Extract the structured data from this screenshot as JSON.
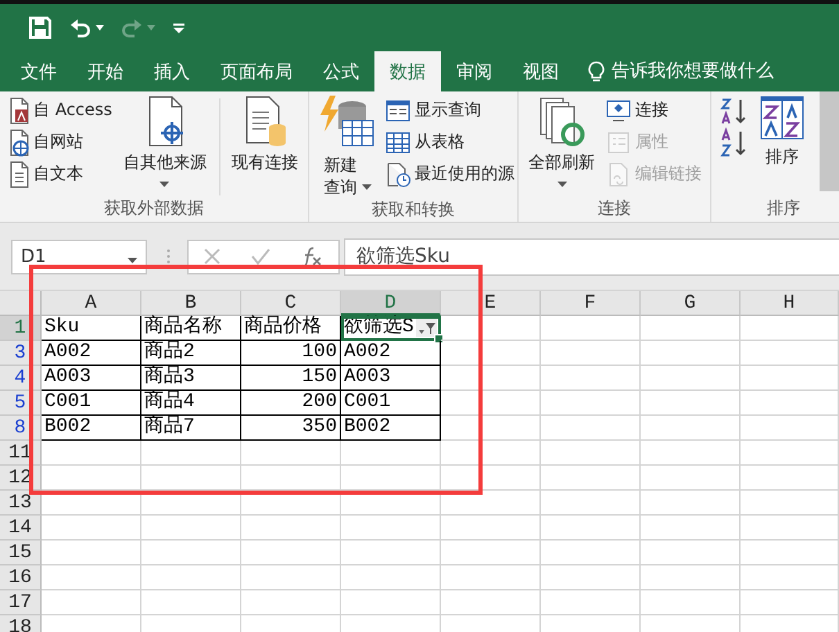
{
  "quick_access": [
    {
      "kind": "save",
      "disabled": false
    },
    {
      "kind": "undo",
      "disabled": false
    },
    {
      "kind": "redo",
      "disabled": true
    },
    {
      "kind": "customize",
      "disabled": false
    }
  ],
  "tabs": [
    {
      "label": "文件",
      "selected": false
    },
    {
      "label": "开始",
      "selected": false
    },
    {
      "label": "插入",
      "selected": false
    },
    {
      "label": "页面布局",
      "selected": false
    },
    {
      "label": "公式",
      "selected": false
    },
    {
      "label": "数据",
      "selected": true
    },
    {
      "label": "审阅",
      "selected": false
    },
    {
      "label": "视图",
      "selected": false
    }
  ],
  "tell_me": {
    "placeholder": "告诉我你想要做什么"
  },
  "ribbon_groups": [
    {
      "label": "获取外部数据",
      "items": [
        {
          "kind": "stack",
          "items": [
            {
              "label": "自 Access",
              "disabled": false
            },
            {
              "label": "自网站",
              "disabled": false
            },
            {
              "label": "自文本",
              "disabled": false
            }
          ]
        },
        {
          "kind": "large",
          "label": "自其他来源",
          "dropdown": true
        },
        {
          "kind": "separator"
        },
        {
          "kind": "large",
          "label": "现有连接",
          "dropdown": false
        }
      ]
    },
    {
      "label": "获取和转换",
      "items": [
        {
          "kind": "large",
          "label": "新建查询",
          "dropdown": true
        },
        {
          "kind": "stack",
          "items": [
            {
              "label": "显示查询",
              "disabled": false
            },
            {
              "label": "从表格",
              "disabled": false
            },
            {
              "label": "最近使用的源",
              "disabled": false
            }
          ]
        }
      ]
    },
    {
      "label": "连接",
      "items": [
        {
          "kind": "large",
          "label": "全部刷新",
          "dropdown": true
        },
        {
          "kind": "stack",
          "items": [
            {
              "label": "连接",
              "disabled": false
            },
            {
              "label": "属性",
              "disabled": true
            },
            {
              "label": "编辑链接",
              "disabled": true
            }
          ]
        }
      ]
    },
    {
      "label": "排序",
      "items": [
        {
          "kind": "stack",
          "items": [
            {
              "disabled": false
            },
            {
              "disabled": false
            }
          ]
        },
        {
          "kind": "large",
          "label": "排序",
          "dropdown": false
        },
        {
          "kind": "cut"
        }
      ]
    }
  ],
  "formula_bar": {
    "name_box": "D1",
    "value": "欲筛选Sku"
  },
  "sheet": {
    "columns": [
      {
        "label": "A",
        "selected": false
      },
      {
        "label": "B",
        "selected": false
      },
      {
        "label": "C",
        "selected": false
      },
      {
        "label": "D",
        "selected": true
      },
      {
        "label": "E",
        "selected": false
      },
      {
        "label": "F",
        "selected": false
      },
      {
        "label": "G",
        "selected": false
      },
      {
        "label": "H",
        "selected": false
      }
    ],
    "rows": [
      {
        "number": "1",
        "selected": true,
        "filtered": false,
        "cells": [
          {
            "text": "Sku",
            "kind": "text"
          },
          {
            "text": "商品名称",
            "kind": "text"
          },
          {
            "text": "商品价格",
            "kind": "text"
          },
          {
            "text": "欲筛选S",
            "kind": "text",
            "filter": true,
            "active": true
          }
        ]
      },
      {
        "number": "3",
        "selected": false,
        "filtered": true,
        "cells": [
          {
            "text": "A002",
            "kind": "text"
          },
          {
            "text": "商品2",
            "kind": "text"
          },
          {
            "text": "100",
            "kind": "number"
          },
          {
            "text": "A002",
            "kind": "text"
          }
        ]
      },
      {
        "number": "4",
        "selected": false,
        "filtered": true,
        "cells": [
          {
            "text": "A003",
            "kind": "text"
          },
          {
            "text": "商品3",
            "kind": "text"
          },
          {
            "text": "150",
            "kind": "number"
          },
          {
            "text": "A003",
            "kind": "text"
          }
        ]
      },
      {
        "number": "5",
        "selected": false,
        "filtered": true,
        "cells": [
          {
            "text": "C001",
            "kind": "text"
          },
          {
            "text": "商品4",
            "kind": "text"
          },
          {
            "text": "200",
            "kind": "number"
          },
          {
            "text": "C001",
            "kind": "text"
          }
        ]
      },
      {
        "number": "8",
        "selected": false,
        "filtered": true,
        "cells": [
          {
            "text": "B002",
            "kind": "text"
          },
          {
            "text": "商品7",
            "kind": "text"
          },
          {
            "text": "350",
            "kind": "number"
          },
          {
            "text": "B002",
            "kind": "text"
          }
        ]
      },
      {
        "number": "11",
        "selected": false,
        "filtered": false
      },
      {
        "number": "12",
        "selected": false,
        "filtered": false
      },
      {
        "number": "13",
        "selected": false,
        "filtered": false
      },
      {
        "number": "14",
        "selected": false,
        "filtered": false
      },
      {
        "number": "15",
        "selected": false,
        "filtered": false
      },
      {
        "number": "16",
        "selected": false,
        "filtered": false
      },
      {
        "number": "17",
        "selected": false,
        "filtered": false
      },
      {
        "number": "18",
        "selected": false,
        "filtered": false
      }
    ]
  },
  "annotations": [
    {
      "kind": "rectangle"
    }
  ]
}
